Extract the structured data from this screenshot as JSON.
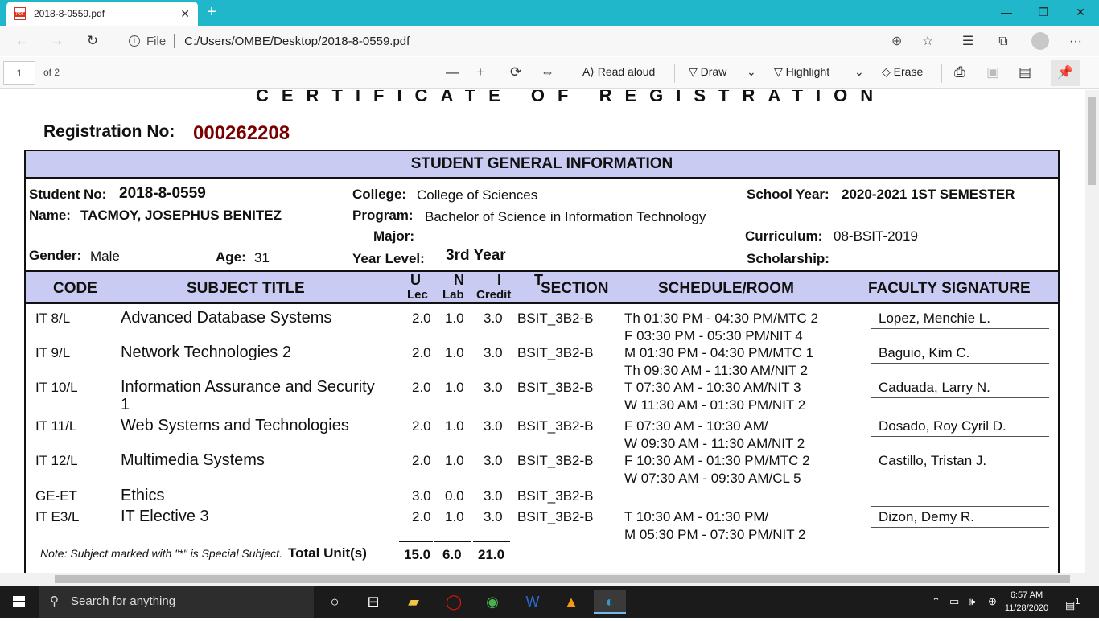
{
  "tab": {
    "title": "2018-8-0559.pdf",
    "close": "✕",
    "new": "+"
  },
  "window": {
    "minimize": "—",
    "restore": "❐",
    "close": "✕"
  },
  "address": {
    "file_label": "File",
    "url": "C:/Users/OMBE/Desktop/2018-8-0559.pdf"
  },
  "pdf_toolbar": {
    "page": "1",
    "of_pages": "of 2",
    "read_aloud": "Read aloud",
    "draw": "Draw",
    "highlight": "Highlight",
    "erase": "Erase"
  },
  "doc": {
    "certificate_title": "CERTIFICATE OF REGISTRATION",
    "registration_label": "Registration No:",
    "registration_no": "000262208",
    "section_title": "STUDENT GENERAL INFORMATION",
    "student_no_label": "Student No:",
    "student_no": "2018-8-0559",
    "name_label": "Name:",
    "name": "TACMOY, JOSEPHUS BENITEZ",
    "gender_label": "Gender:",
    "gender": "Male",
    "age_label": "Age:",
    "age": "31",
    "college_label": "College:",
    "college": "College of Sciences",
    "program_label": "Program:",
    "program": "Bachelor of Science in Information Technology",
    "major_label": "Major:",
    "year_level_label": "Year Level:",
    "year_level": "3rd Year",
    "school_year_label": "School Year:",
    "school_year": "2020-2021 1ST SEMESTER",
    "curriculum_label": "Curriculum:",
    "curriculum": "08-BSIT-2019",
    "scholarship_label": "Scholarship:",
    "headers": {
      "code": "CODE",
      "subject_title": "SUBJECT TITLE",
      "unit": "U N I T",
      "lec": "Lec",
      "lab": "Lab",
      "credit": "Credit",
      "section": "SECTION",
      "schedule": "SCHEDULE/ROOM",
      "faculty": "FACULTY SIGNATURE"
    },
    "subjects": [
      {
        "code": "IT 8/L",
        "title": "Advanced Database Systems",
        "title2": "",
        "lec": "2.0",
        "lab": "1.0",
        "credit": "3.0",
        "section": "BSIT_3B2-B",
        "sched1": "Th 01:30 PM - 04:30 PM/MTC 2",
        "sched2": "F 03:30 PM - 05:30 PM/NIT 4",
        "faculty": "Lopez, Menchie L."
      },
      {
        "code": "IT 9/L",
        "title": "Network Technologies 2",
        "title2": "",
        "lec": "2.0",
        "lab": "1.0",
        "credit": "3.0",
        "section": "BSIT_3B2-B",
        "sched1": "M 01:30 PM - 04:30 PM/MTC 1",
        "sched2": "Th 09:30 AM - 11:30 AM/NIT 2",
        "faculty": "Baguio, Kim C."
      },
      {
        "code": "IT 10/L",
        "title": "Information Assurance and Security",
        "title2": "1",
        "lec": "2.0",
        "lab": "1.0",
        "credit": "3.0",
        "section": "BSIT_3B2-B",
        "sched1": "T 07:30 AM - 10:30 AM/NIT 3",
        "sched2": "W 11:30 AM - 01:30 PM/NIT 2",
        "faculty": "Caduada, Larry  N."
      },
      {
        "code": "IT 11/L",
        "title": "Web Systems and Technologies",
        "title2": "",
        "lec": "2.0",
        "lab": "1.0",
        "credit": "3.0",
        "section": "BSIT_3B2-B",
        "sched1": "F 07:30 AM - 10:30 AM/",
        "sched2": "W 09:30 AM - 11:30 AM/NIT 2",
        "faculty": "Dosado, Roy Cyril D."
      },
      {
        "code": "IT 12/L",
        "title": "Multimedia Systems",
        "title2": "",
        "lec": "2.0",
        "lab": "1.0",
        "credit": "3.0",
        "section": "BSIT_3B2-B",
        "sched1": "F 10:30 AM - 01:30 PM/MTC 2",
        "sched2": "W 07:30 AM - 09:30 AM/CL 5",
        "faculty": "Castillo, Tristan J."
      },
      {
        "code": "GE-ET",
        "title": "Ethics",
        "title2": "",
        "lec": "3.0",
        "lab": "0.0",
        "credit": "3.0",
        "section": "BSIT_3B2-B",
        "sched1": "",
        "sched2": "",
        "faculty": ""
      },
      {
        "code": "IT E3/L",
        "title": "IT Elective 3",
        "title2": "",
        "lec": "2.0",
        "lab": "1.0",
        "credit": "3.0",
        "section": "BSIT_3B2-B",
        "sched1": "T 10:30 AM - 01:30 PM/",
        "sched2": "M 05:30 PM - 07:30 PM/NIT 2",
        "faculty": "Dizon, Demy R."
      }
    ],
    "note": "Note: Subject marked with \"*\" is Special Subject.",
    "total_label": "Total Unit(s)",
    "total_lec": "15.0",
    "total_lab": "6.0",
    "total_credit": "21.0"
  },
  "taskbar": {
    "search_placeholder": "Search for anything",
    "time": "6:57 AM",
    "date": "11/28/2020",
    "notifications": "1"
  }
}
